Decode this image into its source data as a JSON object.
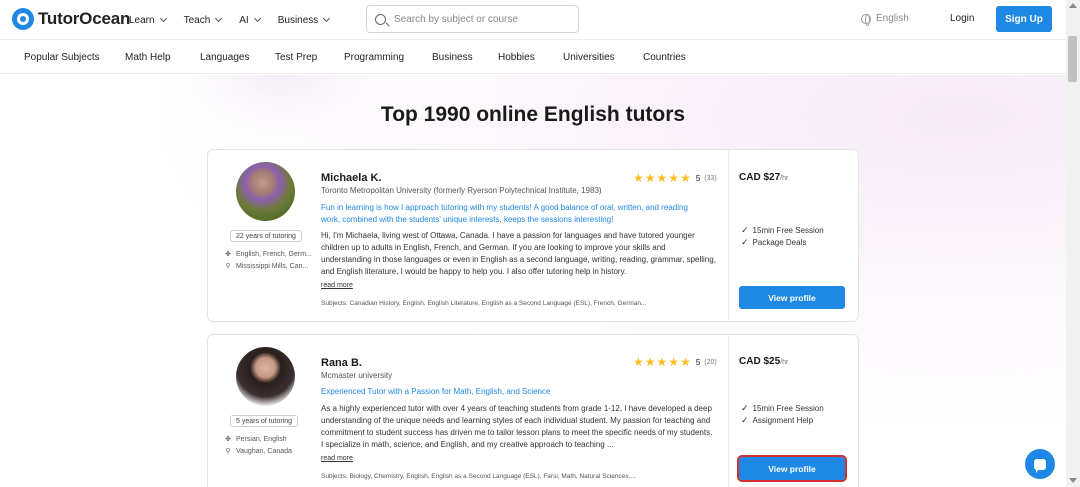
{
  "header": {
    "logo_text": "TutorOcean",
    "menu": [
      {
        "label": "Learn"
      },
      {
        "label": "Teach"
      },
      {
        "label": "AI"
      },
      {
        "label": "Business"
      }
    ],
    "search_placeholder": "Search by subject or course",
    "language": "English",
    "login_label": "Login",
    "signup_label": "Sign Up"
  },
  "categories": [
    "Popular Subjects",
    "Math Help",
    "Languages",
    "Test Prep",
    "Programming",
    "Business",
    "Hobbies",
    "Universities",
    "Countries"
  ],
  "page_title": "Top 1990 online English tutors",
  "tutors": [
    {
      "name": "Michaela K.",
      "university": "Toronto Metropolitan University (formerly Ryerson Polytechnical Institute, 1983)",
      "tagline": "Fun in learning is how I approach tutoring with my students! A good balance of oral, written, and reading work, combined with the students' unique interests, keeps the sessions interesting!",
      "description": "Hi, I'm Michaela, living west of Ottawa, Canada.  I have a passion for languages and have tutored younger children up to  adults in English, French, and German.   If you are looking to improve your skills and understanding in those languages or even in English as a second language,  writing,  reading, grammar, spelling, and English literature, I would be happy to help you. I also offer tutoring help in history.",
      "read_more": "read more",
      "subjects": "Subjects: Canadian History, English, English Literature, English as a Second Language (ESL), French, German...",
      "experience": "22 years of tutoring",
      "languages": "English, French, Germ...",
      "location": "Mississippi Mills, Can...",
      "rating": "5",
      "reviews": "(33)",
      "price": "CAD $27",
      "price_unit": "/hr",
      "features": [
        "15min Free Session",
        "Package Deals"
      ],
      "cta": "View profile"
    },
    {
      "name": "Rana B.",
      "university": "Mcmaster university",
      "tagline": "Experienced Tutor with a Passion for Math, English, and Science",
      "description": "As a highly experienced tutor with over 4 years of teaching students from grade 1-12, I have developed a deep understanding of the unique needs and learning styles of each individual student. My passion for teaching and commitment to student success has driven me to tailor lesson plans to meet the specific needs of my students. I specialize in math, science, and English, and my creative approach to teaching ...",
      "read_more": "read more",
      "subjects": "Subjects: Biology, Chemistry, English, English as a Second Language (ESL), Farsi, Math, Natural Sciences,...",
      "experience": "5 years of tutoring",
      "languages": "Persian, English",
      "location": "Vaughan, Canada",
      "rating": "5",
      "reviews": "(20)",
      "price": "CAD $25",
      "price_unit": "/hr",
      "features": [
        "15min Free Session",
        "Assignment Help"
      ],
      "cta": "View profile"
    }
  ],
  "colors": {
    "brand_blue": "#1e88e5",
    "star_yellow": "#fbbf24",
    "focus_outline": "#d32f2f"
  }
}
